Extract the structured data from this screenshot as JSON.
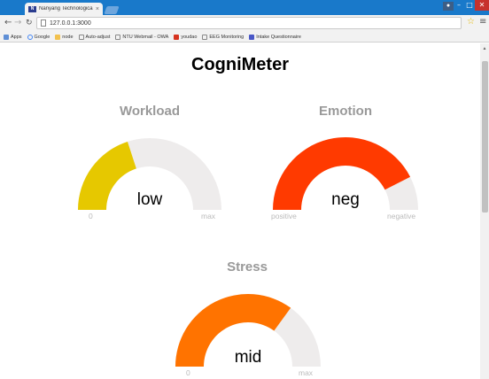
{
  "browser": {
    "tab_title": "Nanyang Technological",
    "tab_close": "×",
    "url": "127.0.0.1:3000",
    "bookmarks": [
      {
        "icon": "apps-icon",
        "label": "Apps"
      },
      {
        "icon": "google-icon",
        "label": "Google"
      },
      {
        "icon": "folder-icon",
        "label": "node"
      },
      {
        "icon": "page-icon",
        "label": "Auto-adjust"
      },
      {
        "icon": "page-icon",
        "label": "NTU Webmail - OWA"
      },
      {
        "icon": "youdao-icon",
        "label": "youdao"
      },
      {
        "icon": "page-icon",
        "label": "EEG Monitoring"
      },
      {
        "icon": "intake-icon",
        "label": "Intake Questionnaire"
      }
    ]
  },
  "page": {
    "title": "CogniMeter"
  },
  "gauges": {
    "workload": {
      "label": "Workload",
      "value_text": "low",
      "min_label": "0",
      "max_label": "max",
      "level": 0.4,
      "color": "#e6c800"
    },
    "emotion": {
      "label": "Emotion",
      "value_text": "neg",
      "min_label": "positive",
      "max_label": "negative",
      "level": 0.85,
      "color": "#ff3a00"
    },
    "stress": {
      "label": "Stress",
      "value_text": "mid",
      "min_label": "0",
      "max_label": "max",
      "level": 0.7,
      "color": "#ff7300"
    }
  },
  "colors": {
    "track": "#eeecec",
    "titlebar": "#1979ca",
    "close": "#c7312d"
  }
}
